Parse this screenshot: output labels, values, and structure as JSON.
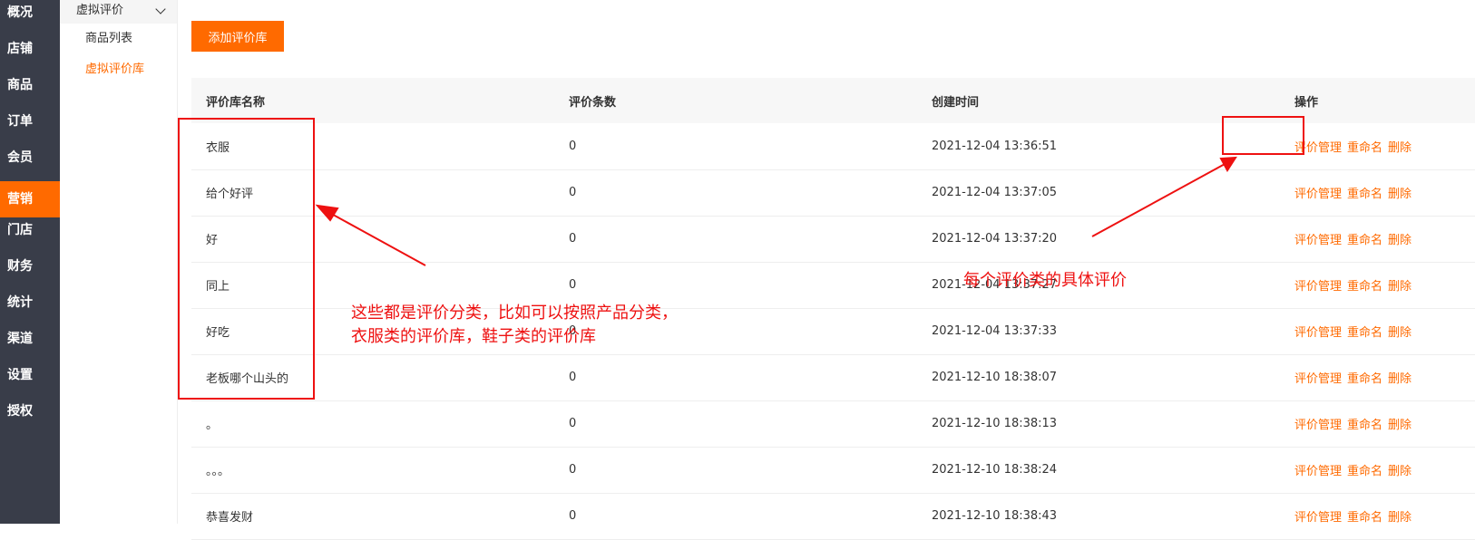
{
  "nav": {
    "items": [
      "概况",
      "店铺",
      "商品",
      "订单",
      "会员",
      "营销",
      "门店",
      "财务",
      "统计",
      "渠道",
      "设置",
      "授权"
    ],
    "active_index": 5
  },
  "subnav": {
    "group": "虚拟评价",
    "items": [
      "商品列表",
      "虚拟评价库"
    ],
    "active_index": 1
  },
  "toolbar": {
    "add_label": "添加评价库"
  },
  "table": {
    "headers": [
      "评价库名称",
      "评价条数",
      "创建时间",
      "操作"
    ],
    "actions": [
      "评价管理",
      "重命名",
      "删除"
    ],
    "rows": [
      {
        "name": "衣服",
        "count": "0",
        "created": "2021-12-04 13:36:51"
      },
      {
        "name": "给个好评",
        "count": "0",
        "created": "2021-12-04 13:37:05"
      },
      {
        "name": "好",
        "count": "0",
        "created": "2021-12-04 13:37:20"
      },
      {
        "name": "同上",
        "count": "0",
        "created": "2021-12-04 13:37:27"
      },
      {
        "name": "好吃",
        "count": "0",
        "created": "2021-12-04 13:37:33"
      },
      {
        "name": "老板哪个山头的",
        "count": "0",
        "created": "2021-12-10 18:38:07"
      },
      {
        "name": "。",
        "count": "0",
        "created": "2021-12-10 18:38:13"
      },
      {
        "name": "。。。",
        "count": "0",
        "created": "2021-12-10 18:38:24"
      },
      {
        "name": "恭喜发财",
        "count": "0",
        "created": "2021-12-10 18:38:43"
      }
    ]
  },
  "annotations": {
    "left_line1": "这些都是评价分类，比如可以按照产品分类，",
    "left_line2": "衣服类的评价库，鞋子类的评价库",
    "right": "每个评价类的具体评价",
    "color": "#ee1111"
  },
  "colors": {
    "accent": "#ff6a00",
    "nav_bg": "#393d49"
  }
}
